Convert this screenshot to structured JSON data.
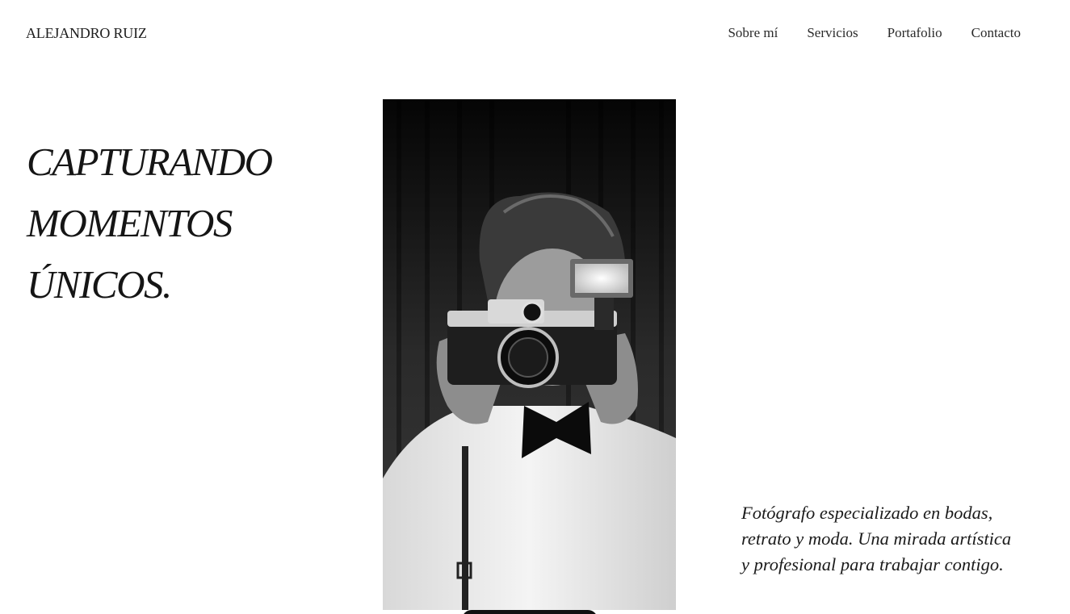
{
  "header": {
    "brand": "ALEJANDRO RUIZ",
    "nav": [
      {
        "label": "Sobre mí"
      },
      {
        "label": "Servicios"
      },
      {
        "label": "Portafolio"
      },
      {
        "label": "Contacto"
      }
    ]
  },
  "hero": {
    "title_lines": [
      "CAPTURANDO",
      "MOMENTOS",
      "ÚNICOS."
    ],
    "description_lines": [
      "Fotógrafo especializado en bodas,",
      "retrato y moda. Una mirada artística",
      "y profesional para trabajar contigo."
    ]
  },
  "colors": {
    "background": "#ffffff",
    "text": "#161616",
    "photo_dark": "#1a1a1a"
  },
  "icons": {
    "photo": "photographer-with-camera-image"
  }
}
